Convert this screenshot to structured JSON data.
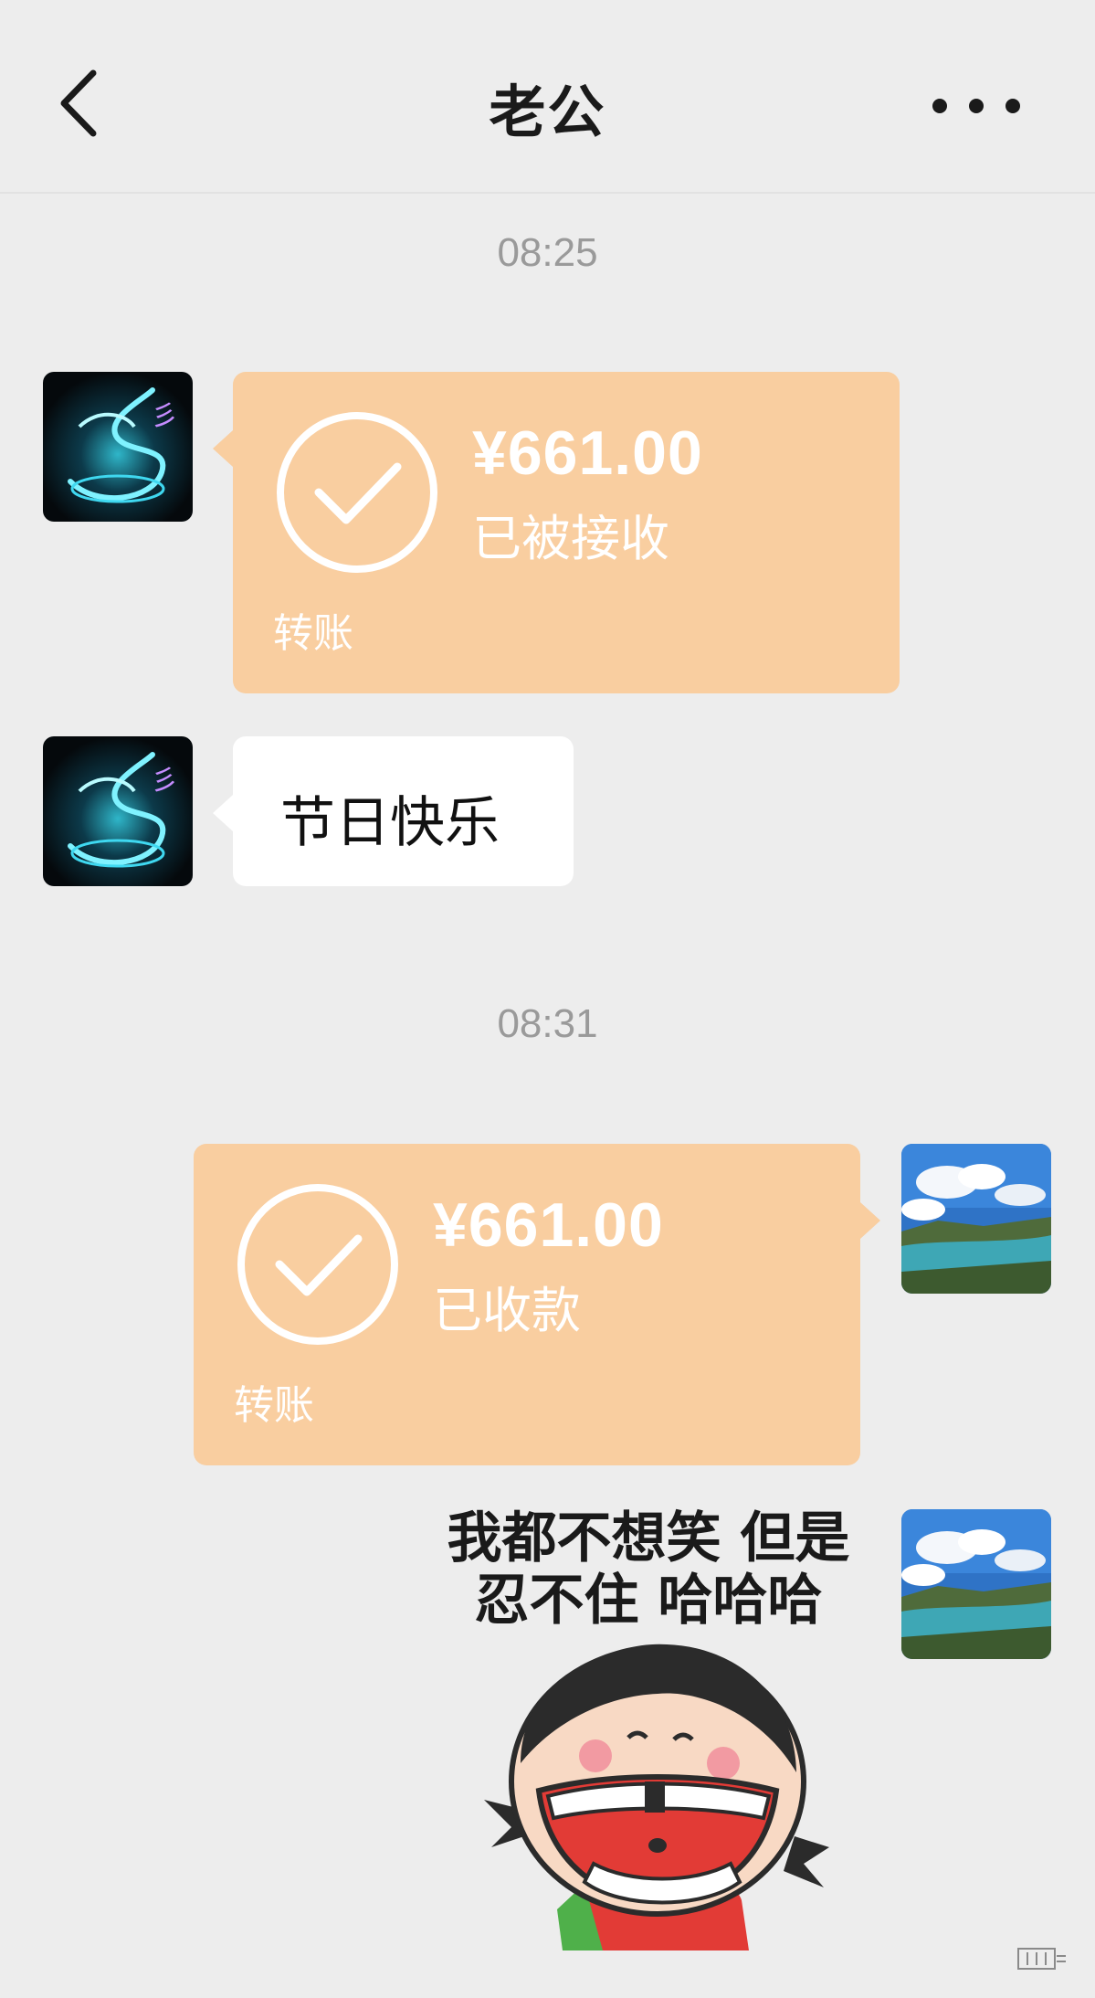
{
  "header": {
    "title": "老公",
    "back_icon": "chevron-left-icon",
    "more_icon": "more-dots-icon"
  },
  "messages": {
    "time_1": "08:25",
    "transfer_1": {
      "amount": "¥661.00",
      "status": "已被接收",
      "label": "转账"
    },
    "text_1": "节日快乐",
    "time_2": "08:31",
    "transfer_2": {
      "amount": "¥661.00",
      "status": "已收款",
      "label": "转账"
    },
    "sticker": {
      "line_1": "我都不想笑 但是",
      "line_2": "忍不住 哈哈哈"
    }
  },
  "colors": {
    "background": "#ededed",
    "transfer_card": "#f9cea0",
    "bubble": "#ffffff",
    "timestamp": "#9a9a9a"
  }
}
